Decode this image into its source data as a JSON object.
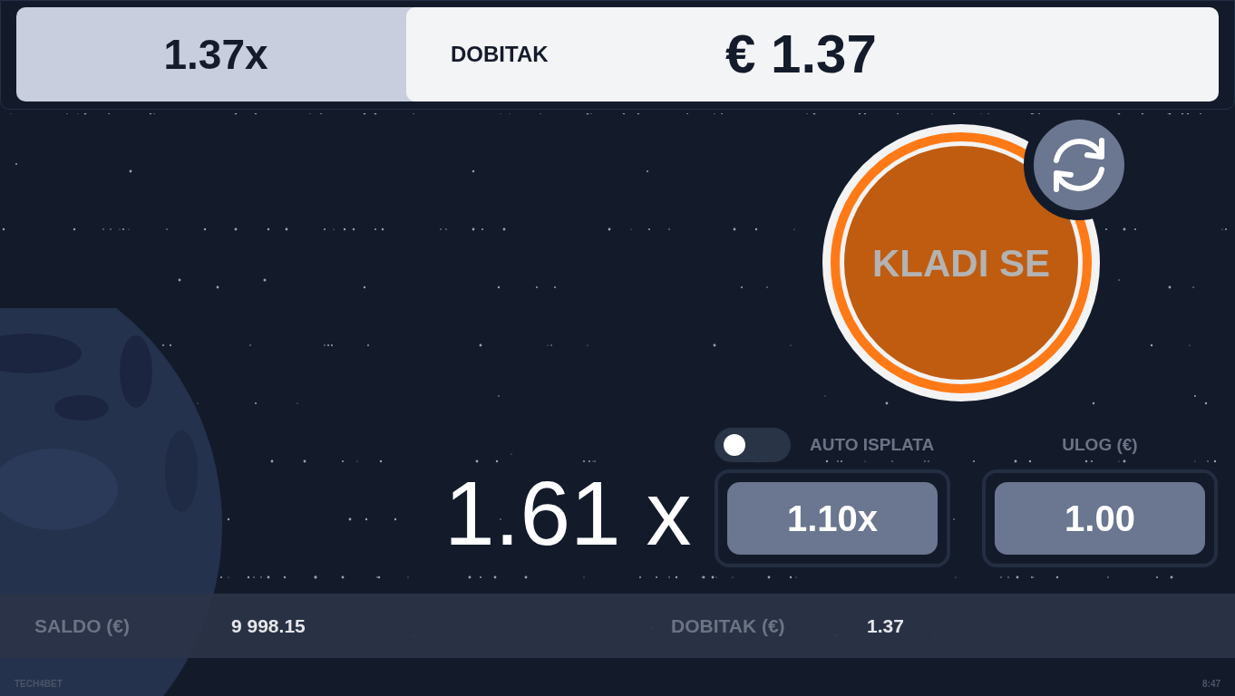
{
  "top_bar": {
    "multiplier": "1.37x",
    "win_label": "DOBITAK",
    "win_amount": "€ 1.37"
  },
  "bet_button": {
    "label": "KLADI SE"
  },
  "current_multiplier": "1.61 x",
  "auto_cashout": {
    "label": "AUTO ISPLATA",
    "on": false,
    "value": "1.10x"
  },
  "stake": {
    "label": "ULOG (€)",
    "value": "1.00"
  },
  "status_bar": {
    "balance_label": "SALDO (€)",
    "balance": "9 998.15",
    "win_label": "DOBITAK (€)",
    "win": "1.37"
  },
  "footer": {
    "brand": "TECH4BET",
    "time": "8:47"
  }
}
